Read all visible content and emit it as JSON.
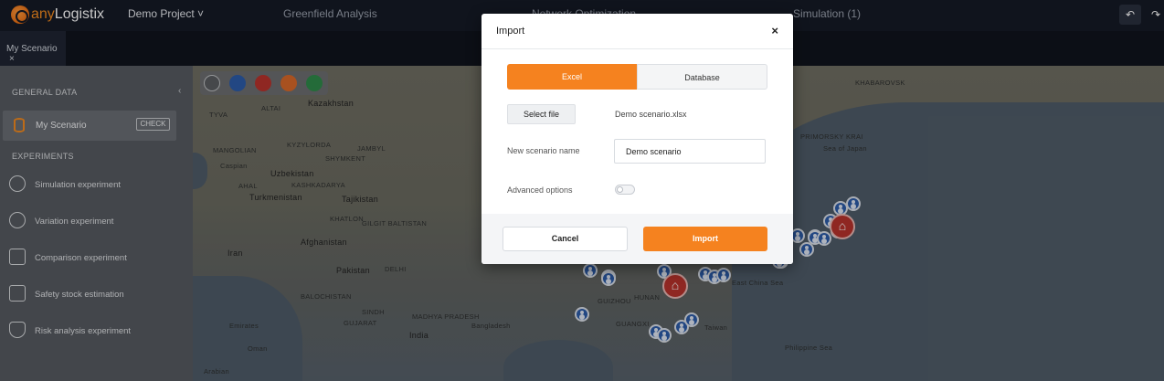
{
  "app": {
    "logo_prefix": "any",
    "logo_suffix": "Logistix"
  },
  "topbar": {
    "project": "Demo Project ˅",
    "nav": [
      "Greenfield Analysis",
      "Network Optimization",
      "Simulation (1)"
    ],
    "undo": "↶",
    "redo": "↷"
  },
  "tabs": [
    {
      "label": "My Scenario",
      "close": "×"
    }
  ],
  "sidebar": {
    "general_header": "GENERAL DATA",
    "scenario": {
      "name": "My Scenario",
      "check_label": "CHECK"
    },
    "experiments_header": "EXPERIMENTS",
    "experiments": [
      {
        "label": "Simulation experiment",
        "icon": "play-circle-icon"
      },
      {
        "label": "Variation experiment",
        "icon": "variation-icon"
      },
      {
        "label": "Comparison experiment",
        "icon": "comparison-icon"
      },
      {
        "label": "Safety stock estimation",
        "icon": "safety-stock-icon"
      },
      {
        "label": "Risk analysis experiment",
        "icon": "risk-shield-icon"
      }
    ],
    "collapse": "‹"
  },
  "map": {
    "labels": [
      "TYVA",
      "ALTAI",
      "Kazakhstan",
      "KHABAROVSK",
      "MANGOLIAN",
      "KYZYLORDA",
      "JAMBYL",
      "Caspian",
      "SHYMKENT",
      "Uzbekistan",
      "Turkmenistan",
      "Tajikistan",
      "Afghanistan",
      "Iran",
      "Pakistan",
      "BALOCHISTAN",
      "SINDH",
      "Emirates",
      "Oman",
      "India",
      "Bangladesh",
      "GUIZHOU",
      "HUNAN",
      "GUANGXI",
      "Taiwan",
      "East China Sea",
      "Philippine Sea",
      "Sea of Japan",
      "PRIMORSKY KRAI",
      "GILGIT BALTISTAN",
      "DELHI",
      "MADHYA PRADESH",
      "GUJARAT",
      "Arabian",
      "KHATLON",
      "AHAL",
      "KASHKADARYA",
      "KHABAROVSK"
    ]
  },
  "dialog": {
    "title": "Import",
    "close": "×",
    "tabs": {
      "excel": "Excel",
      "database": "Database"
    },
    "select_file": "Select file",
    "file_name": "Demo scenario.xlsx",
    "scenario_name_label": "New scenario name",
    "scenario_name_value": "Demo scenario",
    "advanced_label": "Advanced options",
    "advanced_on": false,
    "cancel": "Cancel",
    "import": "Import"
  },
  "colors": {
    "accent": "#f5821f",
    "pin_blue": "#2c5ba8",
    "pin_red": "#b8322c"
  }
}
